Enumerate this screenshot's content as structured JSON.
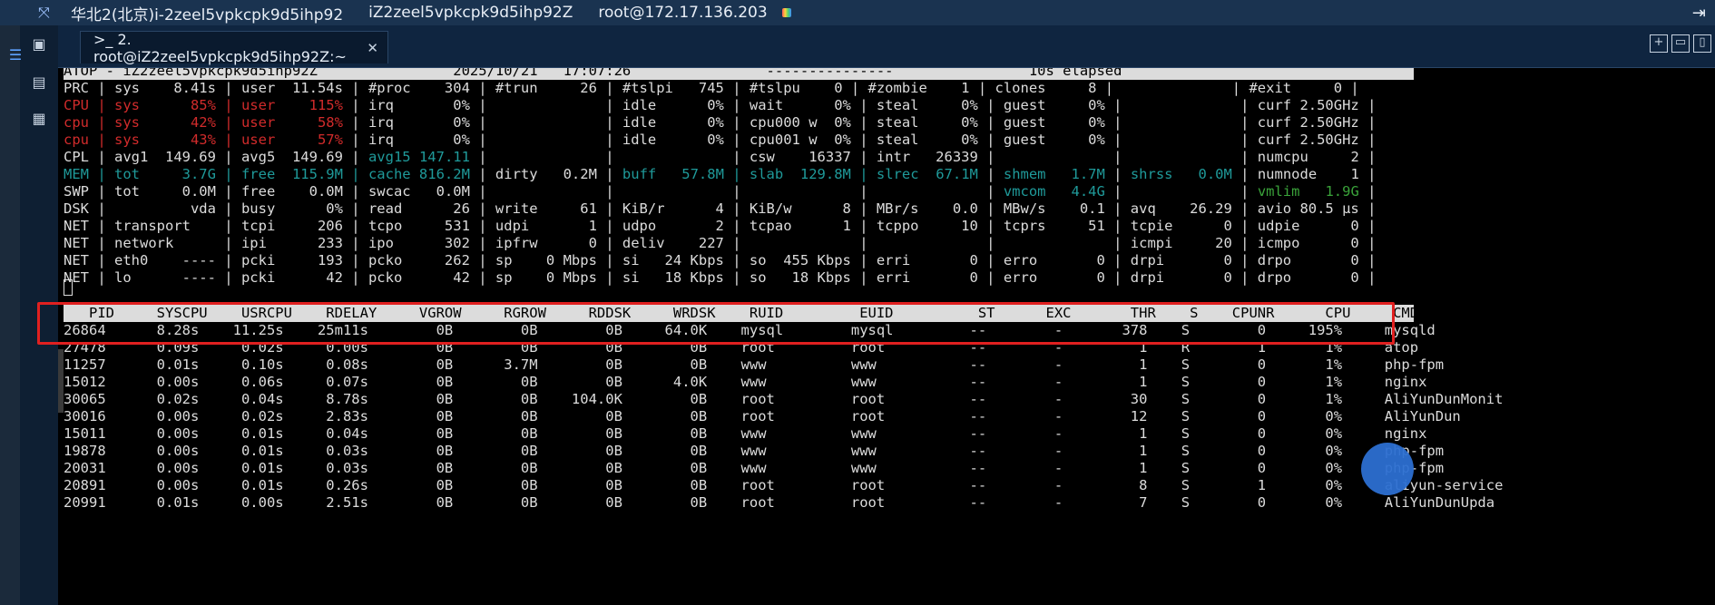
{
  "window": {
    "title_parts": [
      "华北2(北京)i-2zeel5vpkcpk9d5ihp92",
      "iZ2zeel5vpkcpk9d5ihp92Z",
      "root@172.17.136.203"
    ]
  },
  "tab": {
    "label": ">_ 2. root@iZ2zeel5vpkcpk9d5ihp92Z:~",
    "close": "✕"
  },
  "icons": {
    "expand": "expand-icon",
    "exit": "exit-icon",
    "history": "history-icon",
    "terminal": "terminal-icon",
    "files": "files-icon",
    "apps": "apps-icon",
    "new_tab": "add-tab-icon",
    "split": "split-icon"
  },
  "colors": {
    "red": "#d12b2b",
    "teal": "#1f9a9a",
    "green": "#3aa33a",
    "box": "#e02020"
  },
  "atop": {
    "header": "ATOP - iZ2zeel5vpkcpk9d5ihp92Z                2025/10/21   17:07:26                ---------------                10s elapsed",
    "lines": [
      [
        {
          "t": "PRC | sys    8.41s | user  11.54s | #proc    304 | #trun     26 | #tslpi   745 | #tslpu    0 | #zombie    1 | clones     8 |              | #exit     0 |"
        }
      ],
      [
        {
          "t": "CPU | sys      85% | user    115% ",
          "c": "red"
        },
        {
          "t": "| irq       0% |              | idle      0% | wait      0% | steal     0% | guest     0% |              | curf 2.50GHz |"
        }
      ],
      [
        {
          "t": "cpu | sys      42% | user     58% ",
          "c": "red"
        },
        {
          "t": "| irq       0% |              | idle      0% | cpu000 w  0% | steal     0% | guest     0% |              | curf 2.50GHz |"
        }
      ],
      [
        {
          "t": "cpu | sys      43% | user     57% ",
          "c": "red"
        },
        {
          "t": "| irq       0% |              | idle      0% | cpu001 w  0% | steal     0% | guest     0% |              | curf 2.50GHz |"
        }
      ],
      [
        {
          "t": "CPL | avg1  149.69 | avg5  149.69 | "
        },
        {
          "t": "avg15 147.11",
          "c": "teal"
        },
        {
          "t": " |              |              | csw    16337 | intr   26339 |              |              | numcpu     2 |"
        }
      ],
      [
        {
          "t": "MEM | tot     3.7G | free  115.9M | cache 816.2M",
          "c": "teal"
        },
        {
          "t": " | dirty   0.2M | "
        },
        {
          "t": "buff   57.8M | slab  129.8M | slrec  67.1M",
          "c": "teal"
        },
        {
          "t": " | "
        },
        {
          "t": "shmem   1.7M",
          "c": "teal"
        },
        {
          "t": " | "
        },
        {
          "t": "shrss   0.0M",
          "c": "teal"
        },
        {
          "t": " | numnode    1 |"
        }
      ],
      [
        {
          "t": "SWP | tot     0.0M | free    0.0M | swcac   0.0M |              |              |              |              | "
        },
        {
          "t": "vmcom   4.4G",
          "c": "teal"
        },
        {
          "t": " |              | "
        },
        {
          "t": "vmlim   1.9G",
          "c": "green"
        },
        {
          "t": " |"
        }
      ],
      [
        {
          "t": "DSK |          vda | busy      0% | read      26 | write     61 | KiB/r      4 | KiB/w      8 | MBr/s    0.0 | MBw/s    0.1 | avq    26.29 | avio 80.5 µs |"
        }
      ],
      [
        {
          "t": "NET | transport    | tcpi     206 | tcpo     531 | udpi       1 | udpo       2 | tcpao      1 | tcppo     10 | tcprs     51 | tcpie      0 | udpie      0 |"
        }
      ],
      [
        {
          "t": "NET | network      | ipi      233 | ipo      302 | ipfrw      0 | deliv    227 |              |              |              | icmpi     20 | icmpo      0 |"
        }
      ],
      [
        {
          "t": "NET | eth0    ---- | pcki     193 | pcko     262 | sp    0 Mbps | si   24 Kbps | so  455 Kbps | erri       0 | erro       0 | drpi       0 | drpo       0 |"
        }
      ],
      [
        {
          "t": "NET | lo      ---- | pcki      42 | pcko      42 | sp    0 Mbps | si   18 Kbps | so   18 Kbps | erri       0 | erro       0 | drpi       0 | drpo       0 |"
        }
      ]
    ],
    "proc_header": "   PID     SYSCPU    USRCPU    RDELAY     VGROW     RGROW     RDDSK     WRDSK    RUID         EUID          ST      EXC       THR    S    CPUNR      CPU     CMD           1/3",
    "rows": [
      "26864      8.28s    11.25s    25m11s        0B        0B        0B     64.0K    mysql        mysql         --        -       378    S        0     195%     mysqld",
      "27478      0.09s     0.02s     0.00s        0B        0B        0B        0B    root         root          --        -         1    R        1       1%     atop",
      "11257      0.01s     0.10s     0.08s        0B      3.7M        0B        0B    www          www           --        -         1    S        0       1%     php-fpm",
      "15012      0.00s     0.06s     0.07s        0B        0B        0B      4.0K    www          www           --        -         1    S        0       1%     nginx",
      "30065      0.02s     0.04s     8.78s        0B        0B    104.0K        0B    root         root          --        -        30    S        0       1%     AliYunDunMonit",
      "30016      0.00s     0.02s     2.83s        0B        0B        0B        0B    root         root          --        -        12    S        0       0%     AliYunDun",
      "15011      0.00s     0.01s     0.04s        0B        0B        0B        0B    www          www           --        -         1    S        0       0%     nginx",
      "19878      0.00s     0.01s     0.03s        0B        0B        0B        0B    www          www           --        -         1    S        0       0%     php-fpm",
      "20031      0.00s     0.01s     0.03s        0B        0B        0B        0B    www          www           --        -         1    S        0       0%     php-fpm",
      "20891      0.00s     0.01s     0.26s        0B        0B        0B        0B    root         root          --        -         8    S        1       0%     aliyun-service",
      "20991      0.01s     0.00s     2.51s        0B        0B        0B        0B    root         root          --        -         7    S        0       0%     AliYunDunUpda"
    ]
  }
}
